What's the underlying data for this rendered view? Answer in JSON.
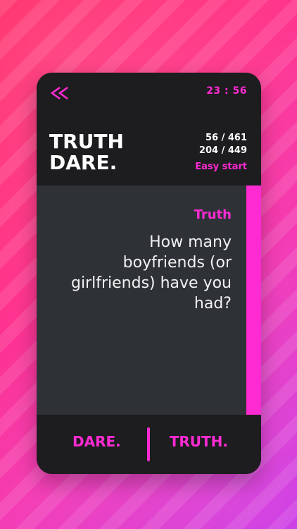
{
  "colors": {
    "accent": "#ff2bd2",
    "card_bg": "#1d1c1f",
    "question_bg": "#2e3237",
    "text_light": "#ffffff"
  },
  "icons": {
    "back": "double-chevron-left-icon"
  },
  "header": {
    "timer": "23 : 56",
    "brand_line1": "TRUTH",
    "brand_line2": "DARE.",
    "stats_line1": "56 / 461",
    "stats_line2": "204 / 449",
    "level": "Easy start"
  },
  "question": {
    "label": "Truth",
    "text": "How many boyfriends (or girlfriends) have you had?"
  },
  "actions": {
    "dare_label": "DARE.",
    "truth_label": "TRUTH."
  }
}
